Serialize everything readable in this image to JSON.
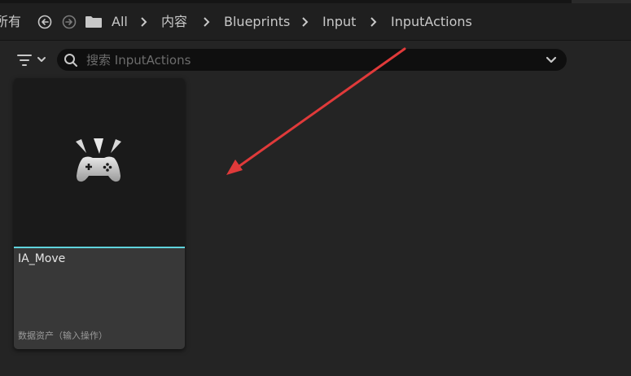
{
  "breadcrumb": {
    "left_fragment": "所有",
    "items": [
      "All",
      "内容",
      "Blueprints",
      "Input",
      "InputActions"
    ]
  },
  "search": {
    "placeholder": "搜索 InputActions"
  },
  "asset": {
    "name": "IA_Move",
    "type": "数据资产（输入操作）",
    "icon": "gamepad-icon",
    "accent_color": "#5fd3dd"
  },
  "annotation": {
    "arrow_color": "#e03a3a"
  }
}
